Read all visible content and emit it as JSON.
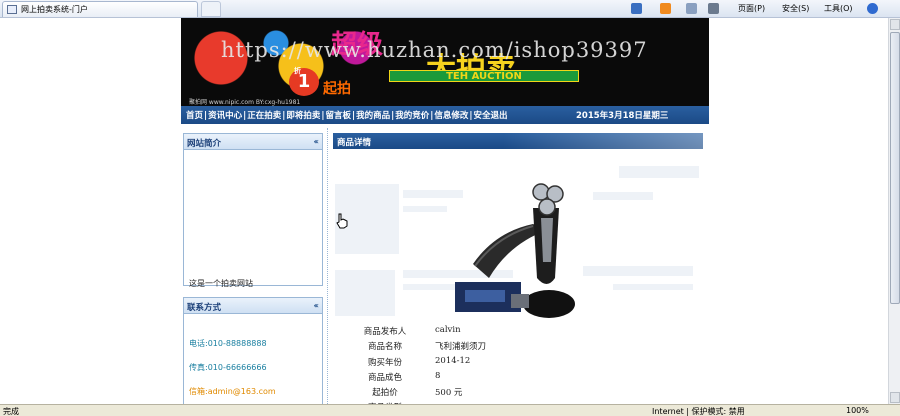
{
  "browser": {
    "tab_title": "网上拍卖系统-门户",
    "toolbar": {
      "page_menu": "页面(P)",
      "safety_menu": "安全(S)",
      "tools_menu": "工具(O)"
    },
    "status": {
      "left": "完成",
      "zone": "Internet | 保护模式: 禁用",
      "zoom": "100%"
    }
  },
  "banner": {
    "title_top": "超级",
    "title_mid": "大拍卖",
    "subtitle": "TEH AUCTION",
    "discount": "1",
    "discount_suffix": "折",
    "start_label": "起拍",
    "watermark": "https://www.huzhan.com/ishop39397",
    "site_url": "聚拍网 www.nipic.com     BY:cxg-hu1981"
  },
  "nav": {
    "items": [
      "首页",
      "资讯中心",
      "正在拍卖",
      "即将拍卖",
      "留言板",
      "我的商品",
      "我的竞价",
      "信息修改",
      "安全退出"
    ],
    "date": "2015年3月18日星期三"
  },
  "sidebar": {
    "about": {
      "title": "网站简介",
      "text": "这是一个拍卖网站"
    },
    "contact": {
      "title": "联系方式",
      "phone": "电话:010-88888888",
      "fax": "传真:010-66666666",
      "email": "信箱:admin@163.com"
    }
  },
  "detail": {
    "title": "商品详情",
    "fields": [
      {
        "label": "商品发布人",
        "value": "calvin"
      },
      {
        "label": "商品名称",
        "value": "飞利浦剃须刀"
      },
      {
        "label": "购买年份",
        "value": "2014-12"
      },
      {
        "label": "商品成色",
        "value": "8"
      },
      {
        "label": "起拍价",
        "value": "500 元"
      },
      {
        "label": "商品类型",
        "value": ""
      }
    ]
  },
  "colors": {
    "nav_blue": "#1b4a86",
    "box_border": "#9ab7d6",
    "contact_phone": "#1a7fa0",
    "contact_email": "#e08a00"
  }
}
